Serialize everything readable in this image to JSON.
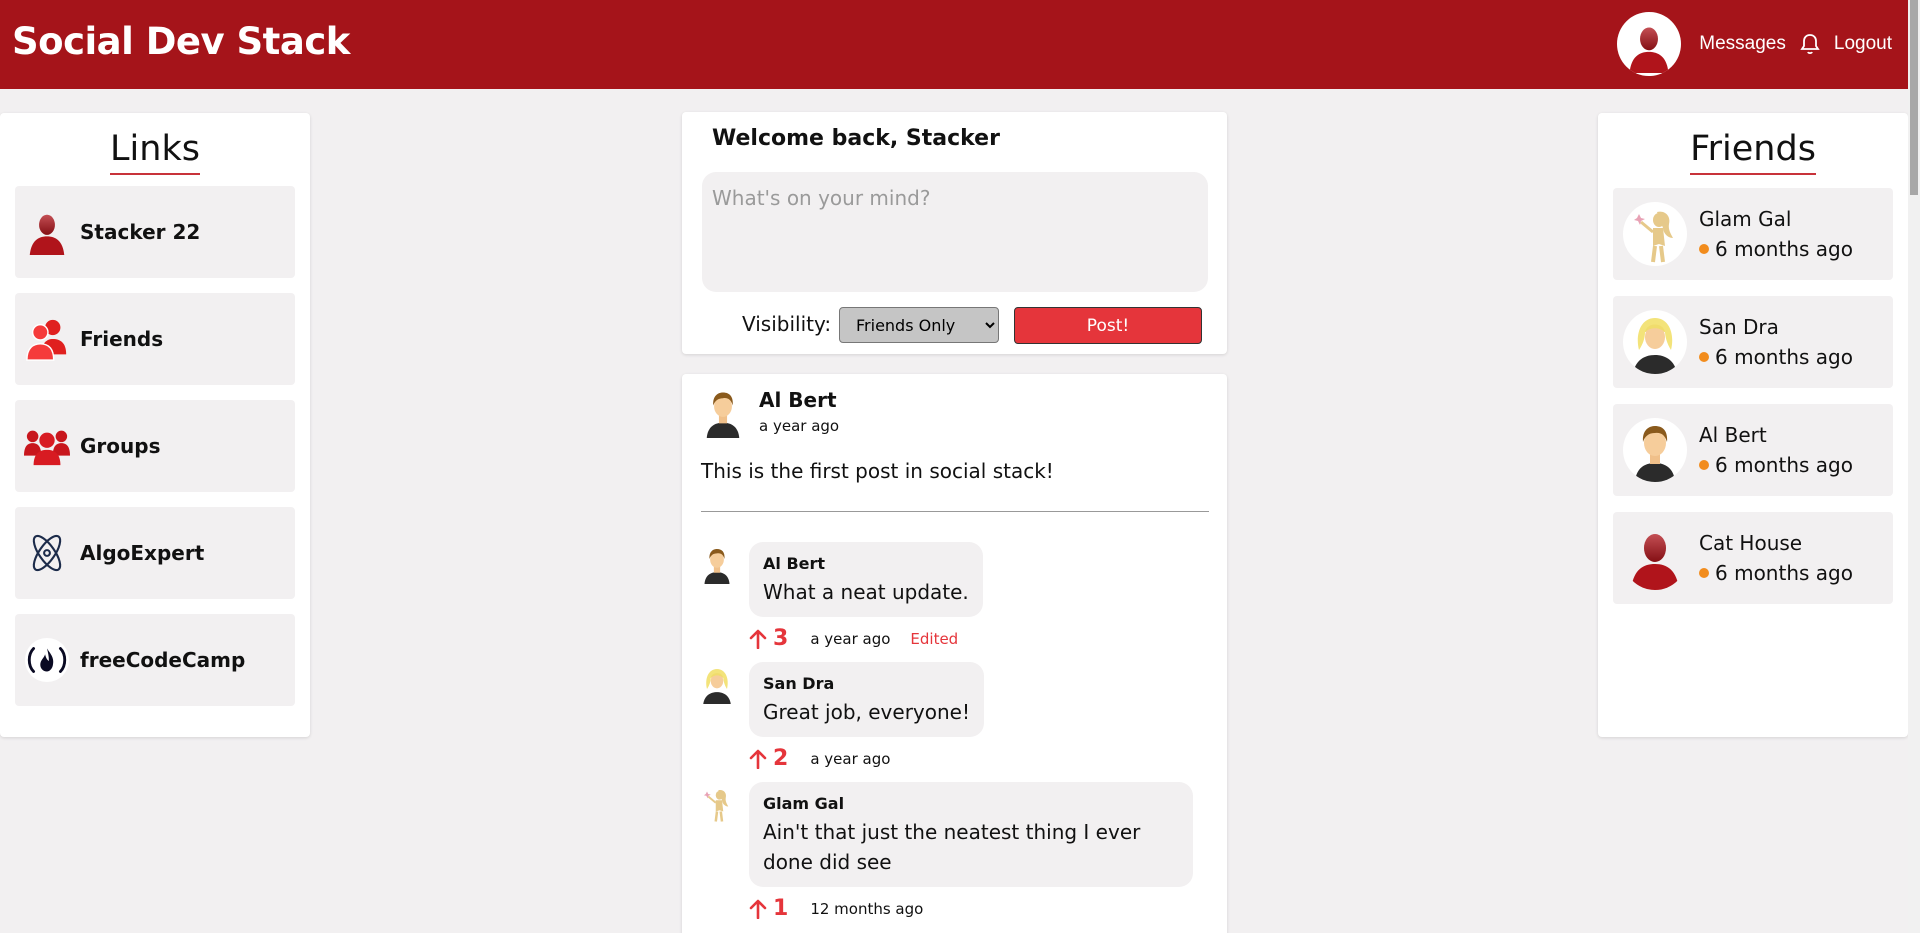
{
  "header": {
    "brand": "Social Dev Stack",
    "messages": "Messages",
    "logout": "Logout",
    "bg_color": "#a5141a"
  },
  "links": {
    "title": "Links",
    "items": [
      {
        "label": "Stacker 22",
        "icon": "user-icon"
      },
      {
        "label": "Friends",
        "icon": "friends-icon"
      },
      {
        "label": "Groups",
        "icon": "groups-icon"
      },
      {
        "label": "AlgoExpert",
        "icon": "atom-icon"
      },
      {
        "label": "freeCodeCamp",
        "icon": "freecodecamp-icon"
      }
    ]
  },
  "friends": {
    "title": "Friends",
    "items": [
      {
        "name": "Glam Gal",
        "status": "6 months ago"
      },
      {
        "name": "San Dra",
        "status": "6 months ago"
      },
      {
        "name": "Al Bert",
        "status": "6 months ago"
      },
      {
        "name": "Cat House",
        "status": "6 months ago"
      }
    ],
    "status_color": "#f28c1d"
  },
  "composer": {
    "title": "Welcome back, Stacker",
    "placeholder": "What's on your mind?",
    "visibility_label": "Visibility:",
    "visibility_value": "Friends Only",
    "post_button": "Post!"
  },
  "post": {
    "author": "Al Bert",
    "time": "a year ago",
    "body": "This is the first post in social stack!",
    "comments": [
      {
        "author": "Al Bert",
        "text": "What a neat update.",
        "votes": "3",
        "time": "a year ago",
        "edited": "Edited"
      },
      {
        "author": "San Dra",
        "text": "Great job, everyone!",
        "votes": "2",
        "time": "a year ago",
        "edited": ""
      },
      {
        "author": "Glam Gal",
        "text": "Ain't that just the neatest thing I ever done did see",
        "votes": "1",
        "time": "12 months ago",
        "edited": ""
      }
    ]
  },
  "accent": "#e5353b"
}
